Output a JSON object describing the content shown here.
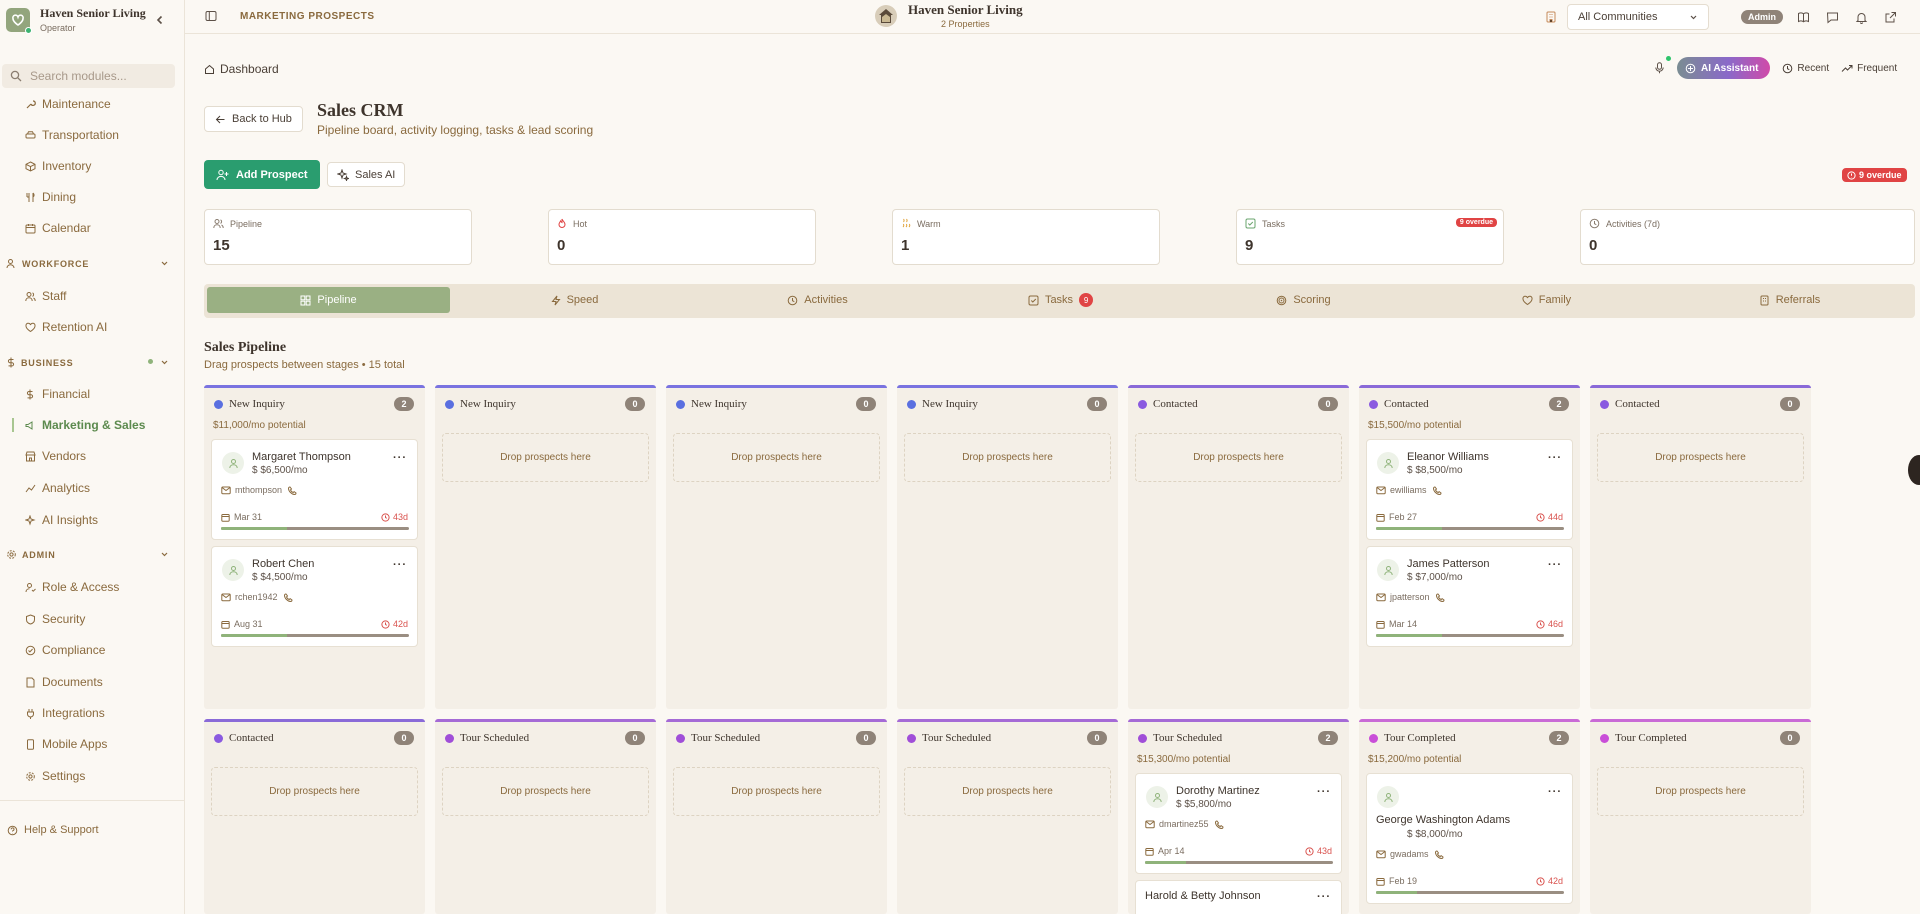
{
  "brand": {
    "name": "Haven Senior Living",
    "role": "Operator"
  },
  "sidebar": {
    "search_placeholder": "Search modules...",
    "items_top": [
      {
        "label": "Maintenance",
        "icon": "wrench-icon"
      },
      {
        "label": "Transportation",
        "icon": "car-icon"
      },
      {
        "label": "Inventory",
        "icon": "box-icon"
      },
      {
        "label": "Dining",
        "icon": "utensils-icon"
      },
      {
        "label": "Calendar",
        "icon": "calendar-icon"
      }
    ],
    "workforce": {
      "label": "WORKFORCE",
      "items": [
        {
          "label": "Staff"
        },
        {
          "label": "Retention AI"
        }
      ]
    },
    "business": {
      "label": "BUSINESS",
      "items": [
        {
          "label": "Financial"
        },
        {
          "label": "Marketing & Sales"
        },
        {
          "label": "Vendors"
        },
        {
          "label": "Analytics"
        },
        {
          "label": "AI Insights"
        }
      ]
    },
    "admin": {
      "label": "ADMIN",
      "items": [
        {
          "label": "Role & Access"
        },
        {
          "label": "Security"
        },
        {
          "label": "Compliance"
        },
        {
          "label": "Documents"
        },
        {
          "label": "Integrations"
        },
        {
          "label": "Mobile Apps"
        },
        {
          "label": "Settings"
        }
      ]
    },
    "help": "Help & Support"
  },
  "topbar": {
    "module": "MARKETING PROSPECTS",
    "org_name": "Haven Senior Living",
    "org_sub": "2 Properties",
    "community_select": "All Communities",
    "admin_badge": "Admin"
  },
  "header": {
    "breadcrumb": "Dashboard",
    "ai_assistant": "AI Assistant",
    "recent": "Recent",
    "frequent": "Frequent",
    "back": "Back to Hub",
    "title": "Sales CRM",
    "subtitle": "Pipeline board, activity logging, tasks & lead scoring",
    "add_prospect": "Add Prospect",
    "sales_ai": "Sales AI",
    "overdue": "9 overdue"
  },
  "stats": [
    {
      "label": "Pipeline",
      "value": "15",
      "icon": "users-icon"
    },
    {
      "label": "Hot",
      "value": "0",
      "icon": "flame-icon"
    },
    {
      "label": "Warm",
      "value": "1",
      "icon": "thermo-icon"
    },
    {
      "label": "Tasks",
      "value": "9",
      "icon": "check-square-icon",
      "badge": "9 overdue"
    },
    {
      "label": "Activities (7d)",
      "value": "0",
      "icon": "clock-icon"
    }
  ],
  "tabs": [
    {
      "label": "Pipeline"
    },
    {
      "label": "Speed"
    },
    {
      "label": "Activities"
    },
    {
      "label": "Tasks",
      "count": "9"
    },
    {
      "label": "Scoring"
    },
    {
      "label": "Family"
    },
    {
      "label": "Referrals"
    }
  ],
  "pipeline": {
    "title": "Sales Pipeline",
    "subtitle": "Drag prospects between stages • 15 total",
    "drop_text": "Drop prospects here",
    "columns": [
      {
        "stage": "New Inquiry",
        "count": "2",
        "potential": "$11,000/mo potential"
      },
      {
        "stage": "New Inquiry",
        "count": "0"
      },
      {
        "stage": "New Inquiry",
        "count": "0"
      },
      {
        "stage": "New Inquiry",
        "count": "0"
      },
      {
        "stage": "Contacted",
        "count": "0"
      },
      {
        "stage": "Contacted",
        "count": "2",
        "potential": "$15,500/mo potential"
      },
      {
        "stage": "Contacted",
        "count": "0"
      },
      {
        "stage": "Contacted",
        "count": "0"
      },
      {
        "stage": "Tour Scheduled",
        "count": "0"
      },
      {
        "stage": "Tour Scheduled",
        "count": "0"
      },
      {
        "stage": "Tour Scheduled",
        "count": "0"
      },
      {
        "stage": "Tour Scheduled",
        "count": "2",
        "potential": "$15,300/mo potential"
      },
      {
        "stage": "Tour Completed",
        "count": "2",
        "potential": "$15,200/mo potential"
      },
      {
        "stage": "Tour Completed",
        "count": "0"
      }
    ],
    "cards": [
      {
        "name": "Margaret Thompson",
        "amount": "$6,500/mo",
        "email": "mthompson",
        "date": "Mar 31",
        "ago": "43d",
        "progress": 0.35
      },
      {
        "name": "Robert Chen",
        "amount": "$4,500/mo",
        "email": "rchen1942",
        "date": "Aug 31",
        "ago": "42d",
        "progress": 0.35
      },
      {
        "name": "Eleanor Williams",
        "amount": "$8,500/mo",
        "email": "ewilliams",
        "date": "Feb 27",
        "ago": "44d",
        "progress": 0.35
      },
      {
        "name": "James Patterson",
        "amount": "$7,000/mo",
        "email": "jpatterson",
        "date": "Mar 14",
        "ago": "46d",
        "progress": 0.35
      },
      {
        "name": "Dorothy Martinez",
        "amount": "$5,800/mo",
        "email": "dmartinez55",
        "date": "Apr 14",
        "ago": "43d",
        "progress": 0.22
      },
      {
        "name": "Harold & Betty Johnson"
      },
      {
        "name": "George Washington Adams",
        "amount": "$8,000/mo",
        "email": "gwadams",
        "date": "Feb 19",
        "ago": "42d",
        "progress": 0.22
      }
    ]
  }
}
